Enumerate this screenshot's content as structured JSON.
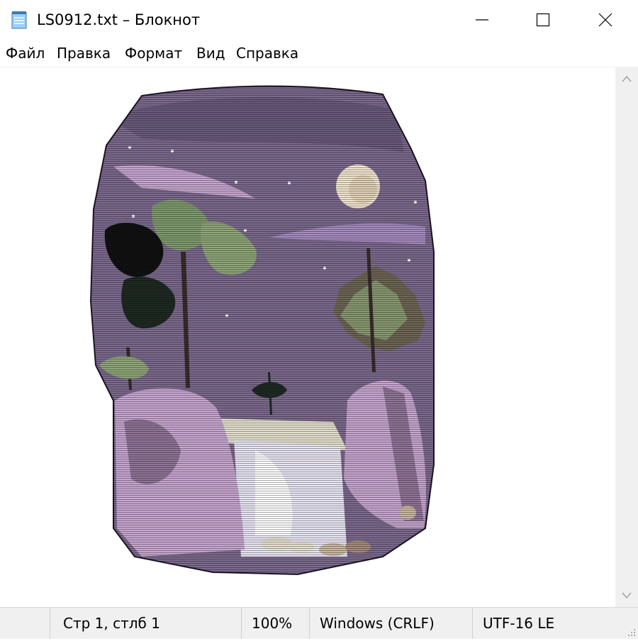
{
  "window": {
    "title": "LS0912.txt – Блокнот"
  },
  "menu": [
    "Файл",
    "Правка",
    "Формат",
    "Вид",
    "Справка"
  ],
  "status": {
    "position": "Стр 1, стлб 1",
    "zoom": "100%",
    "line_ending": "Windows (CRLF)",
    "encoding": "UTF-16 LE"
  },
  "colors": {
    "sky": "#7c6a8e",
    "rock": "#c7a6d0",
    "water": "#e9e6f4",
    "tree": "#7f9a6d",
    "moon": "#f2e6cf"
  }
}
